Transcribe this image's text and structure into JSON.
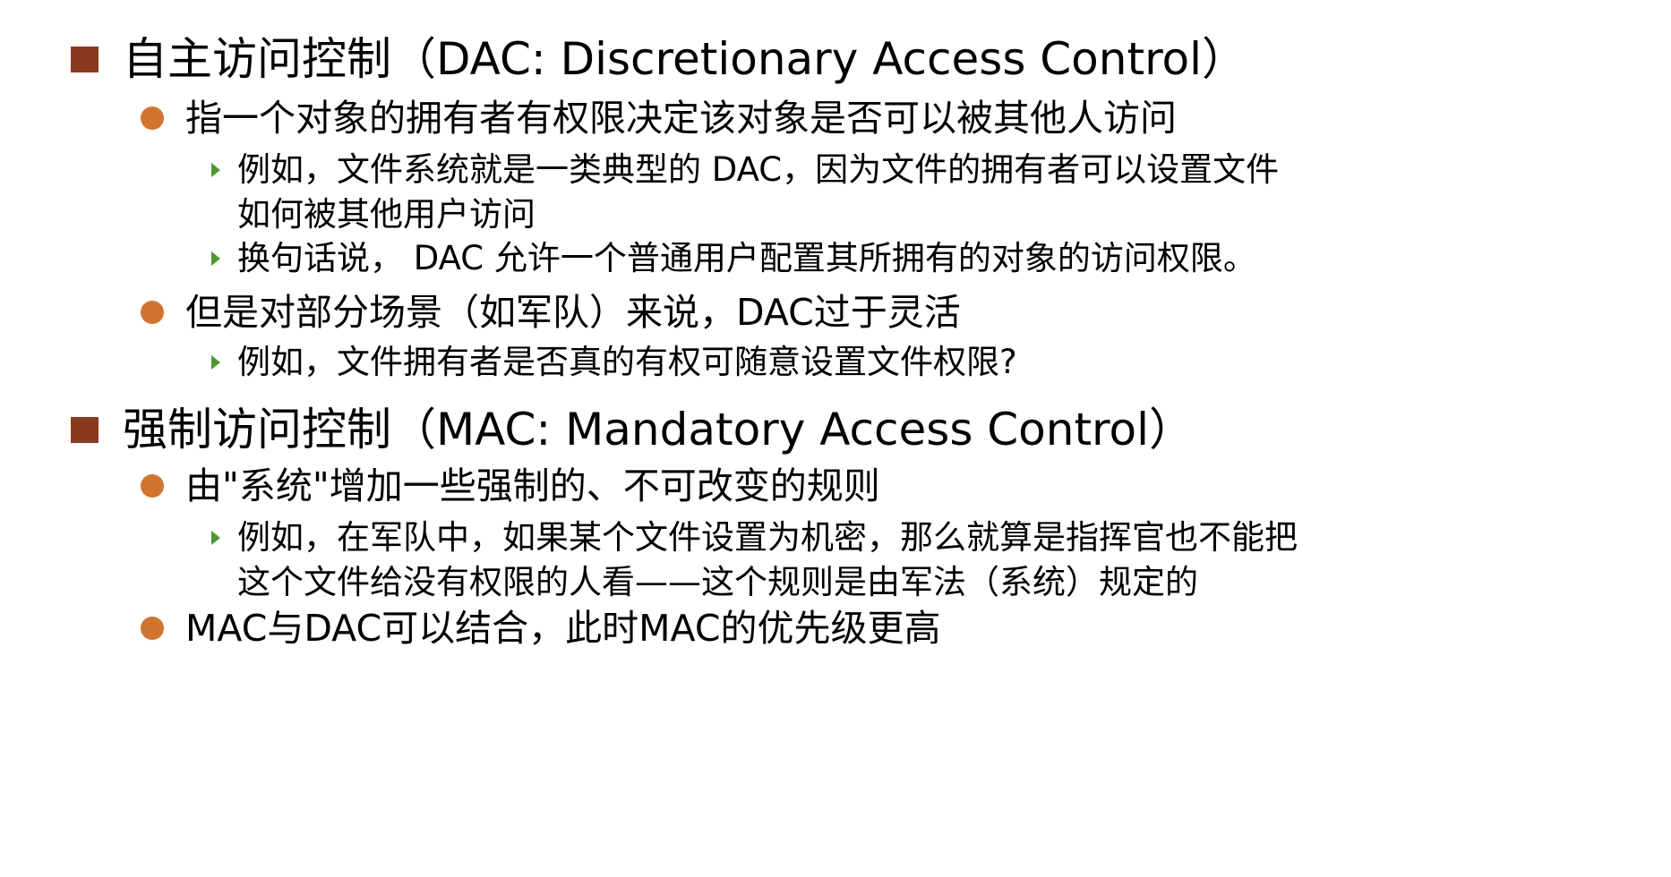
{
  "colors": {
    "level1_bullet": "#8b3a1e",
    "level2_bullet": "#d2742e",
    "level3_bullet": "#4a9a2e"
  },
  "sections": [
    {
      "heading": "自主访问控制（DAC: Discretionary Access Control）",
      "points": [
        {
          "text": "指一个对象的拥有者有权限决定该对象是否可以被其他人访问",
          "subpoints": [
            "例如，文件系统就是一类典型的 DAC，因为文件的拥有者可以设置文件如何被其他用户访问",
            "换句话说， DAC 允许一个普通用户配置其所拥有的对象的访问权限。"
          ]
        },
        {
          "text": "但是对部分场景（如军队）来说，DAC过于灵活",
          "subpoints": [
            "例如，文件拥有者是否真的有权可随意设置文件权限?"
          ]
        }
      ]
    },
    {
      "heading": "强制访问控制（MAC: Mandatory Access Control）",
      "points": [
        {
          "text": "由\"系统\"增加一些强制的、不可改变的规则",
          "subpoints": [
            "例如，在军队中，如果某个文件设置为机密，那么就算是指挥官也不能把这个文件给没有权限的人看——这个规则是由军法（系统）规定的"
          ]
        },
        {
          "text": "MAC与DAC可以结合，此时MAC的优先级更高",
          "subpoints": []
        }
      ]
    }
  ]
}
